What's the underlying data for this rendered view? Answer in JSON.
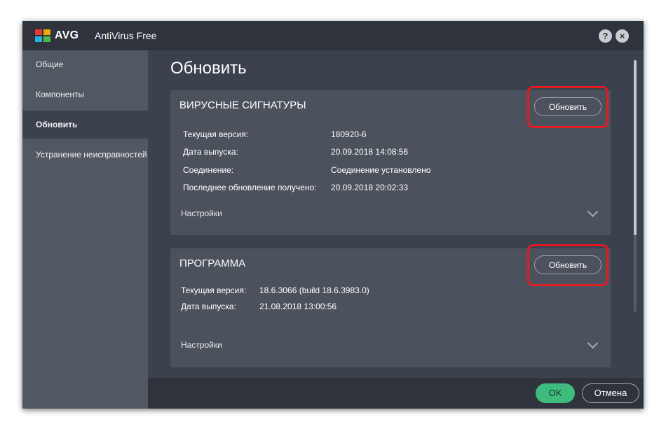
{
  "app": {
    "brand": "AVG",
    "product": "AntiVirus Free",
    "help_glyph": "?",
    "close_glyph": "×"
  },
  "sidebar": {
    "items": [
      {
        "label": "Общие"
      },
      {
        "label": "Компоненты"
      },
      {
        "label": "Обновить",
        "active": true
      },
      {
        "label": "Устранение неисправностей"
      }
    ]
  },
  "main": {
    "title": "Обновить",
    "virus_signatures": {
      "heading": "ВИРУСНЫЕ СИГНАТУРЫ",
      "update_button": "Обновить",
      "rows": [
        {
          "label": "Текущая версия:",
          "value": "180920-6"
        },
        {
          "label": "Дата выпуска:",
          "value": "20.09.2018 14:08:56"
        },
        {
          "label": "Соединение:",
          "value": "Соединение установлено"
        },
        {
          "label": "Последнее обновление получено:",
          "value": "20.09.2018 20:02:33"
        }
      ],
      "settings_label": "Настройки"
    },
    "program": {
      "heading": "ПРОГРАММА",
      "update_button": "Обновить",
      "rows": [
        {
          "label": "Текущая версия:",
          "value": "18.6.3066 (build 18.6.3983.0)"
        },
        {
          "label": "Дата выпуска:",
          "value": "21.08.2018 13:00:56"
        }
      ],
      "settings_label": "Настройки"
    }
  },
  "footer": {
    "ok_label": "OK",
    "cancel_label": "Отмена"
  },
  "colors": {
    "titlebar": "#2f343c",
    "sidebar": "#525861",
    "content": "#3c424d",
    "card": "#4c525c",
    "accent_green": "#3fbc7d",
    "highlight_red": "#e01c24"
  }
}
